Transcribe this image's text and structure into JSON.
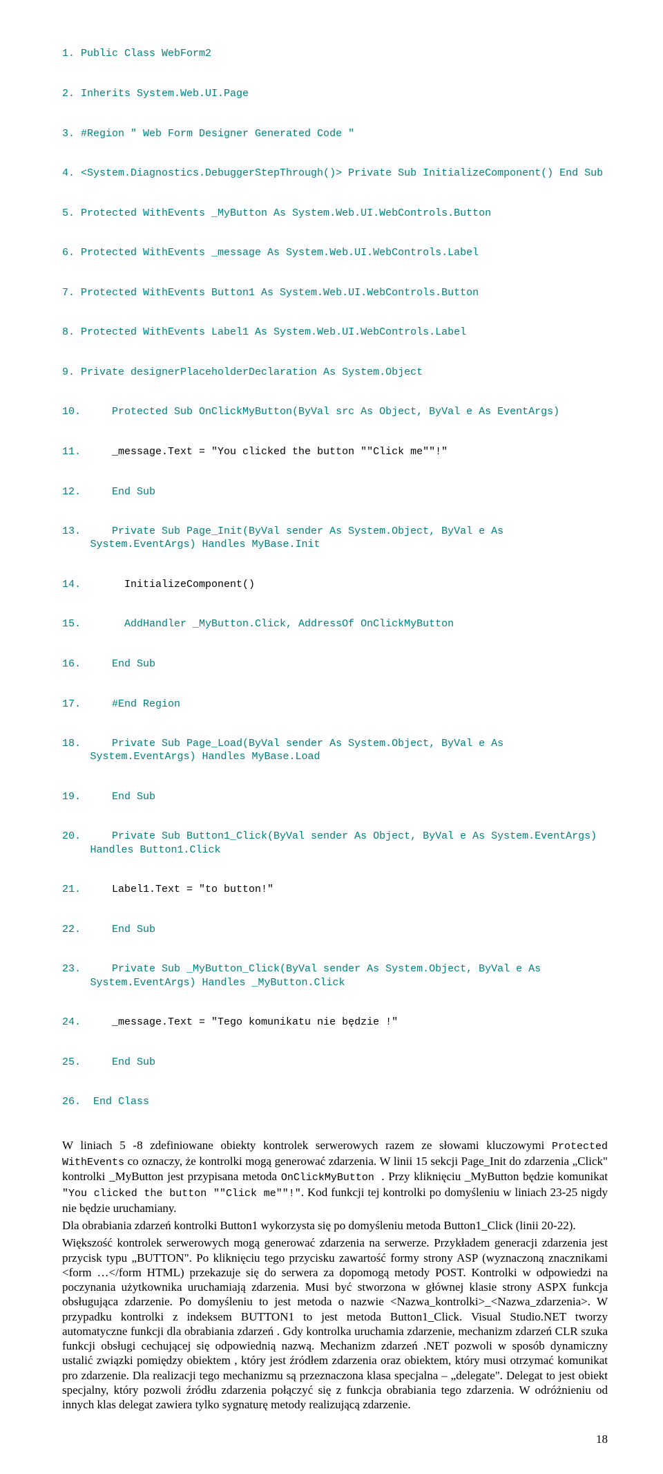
{
  "code": {
    "l1": "1. Public Class WebForm2",
    "l2": "2. Inherits System.Web.UI.Page",
    "l3": "3. #Region \" Web Form Designer Generated Code \"",
    "l4": "4. <System.Diagnostics.DebuggerStepThrough()> Private Sub InitializeComponent() End Sub",
    "l5": "5. Protected WithEvents _MyButton As System.Web.UI.WebControls.Button",
    "l6": "6. Protected WithEvents _message As System.Web.UI.WebControls.Label",
    "l7": "7. Protected WithEvents Button1 As System.Web.UI.WebControls.Button",
    "l8": "8. Protected WithEvents Label1 As System.Web.UI.WebControls.Label",
    "l9": "9. Private designerPlaceholderDeclaration As System.Object",
    "l10": "10.     Protected Sub OnClickMyButton(ByVal src As Object, ByVal e As EventArgs)",
    "l11a": "11.     ",
    "l11b": "_message.Text = \"You clicked the button \"\"Click me\"\"!\"",
    "l12": "12.     End Sub",
    "l13": "13.     Private Sub Page_Init(ByVal sender As System.Object, ByVal e As System.EventArgs) Handles MyBase.Init",
    "l14a": "14.       ",
    "l14b": "InitializeComponent()",
    "l15": "15.       AddHandler _MyButton.Click, AddressOf OnClickMyButton",
    "l16": "16.     End Sub",
    "l17": "17.     #End Region",
    "l18": "18.     Private Sub Page_Load(ByVal sender As System.Object, ByVal e As System.EventArgs) Handles MyBase.Load",
    "l19": "19.     End Sub",
    "l20": "20.     Private Sub Button1_Click(ByVal sender As Object, ByVal e As System.EventArgs) Handles Button1.Click",
    "l21a": "21.     ",
    "l21b": "Label1.Text = \"to button!\"",
    "l22": "22.     End Sub",
    "l23": "23.     Private Sub _MyButton_Click(ByVal sender As System.Object, ByVal e As System.EventArgs) Handles _MyButton.Click",
    "l24a": "24.     ",
    "l24b": "_message.Text = \"Tego komunikatu nie będzie !\"",
    "l25": "25.     End Sub",
    "l26": "26.  End Class"
  },
  "body": {
    "p1a": "W liniach 5 -8 zdefiniowane obiekty kontrolek serwerowych razem ze słowami kluczowymi ",
    "p1b": "Protected WithEvents",
    "p1c": " co oznaczy, że kontrolki mogą generować zdarzenia. W linii 15 sekcji Page_Init do zdarzenia „Click\" kontrolki _MyButton  jest przypisana metoda ",
    "p1d": "OnClickMyButton ",
    "p1e": ". Przy kliknięciu _MyButton  będzie komunikat ",
    "p1f": "\"You clicked the button \"\"Click me\"\"!\"",
    "p1g": ". Kod  funkcji tej kontrolki po domyśleniu w liniach 23-25 nigdy nie będzie uruchamiany.",
    "p2": "Dla obrabiania zdarzeń kontrolki Button1 wykorzysta się po domyśleniu metoda Button1_Click  (linii 20-22).",
    "p3": "Większość kontrolek serwerowych mogą generować zdarzenia na serwerze. Przykładem generacji zdarzenia jest przycisk typu „BUTTON\". Po kliknięciu  tego przycisku zawartość formy strony ASP (wyznaczoną znacznikami <form …</form HTML) przekazuje się do serwera za dopomogą metody POST. Kontrolki w odpowiedzi na poczynania użytkownika uruchamiają zdarzenia. Musi być stworzona w głównej klasie strony ASPX funkcja obsługująca zdarzenie. Po domyśleniu to jest metoda o nazwie <Nazwa_kontrolki>_<Nazwa_zdarzenia>. W przypadku kontrolki z indeksem BUTTON1 to jest metoda Button1_Click. Visual Studio.NET tworzy automatyczne funkcji dla obrabiania zdarzeń . Gdy kontrolka uruchamia zdarzenie, mechanizm zdarzeń CLR szuka funkcji obsługi cechującej się odpowiednią nazwą.  Mechanizm zdarzeń .NET pozwoli w sposób dynamiczny ustalić związki pomiędzy obiektem , który jest źródłem zdarzenia oraz obiektem, który musi otrzymać komunikat pro zdarzenie. Dla realizacji tego mechanizmu są przeznaczona klasa specjalna – „delegate\".  Delegat to jest obiekt specjalny, który pozwoli źródłu zdarzenia połączyć się z funkcja obrabiania tego zdarzenia. W odróżnieniu od innych klas delegat zawiera tylko sygnaturę metody realizującą zdarzenie."
  },
  "page_number": "18"
}
